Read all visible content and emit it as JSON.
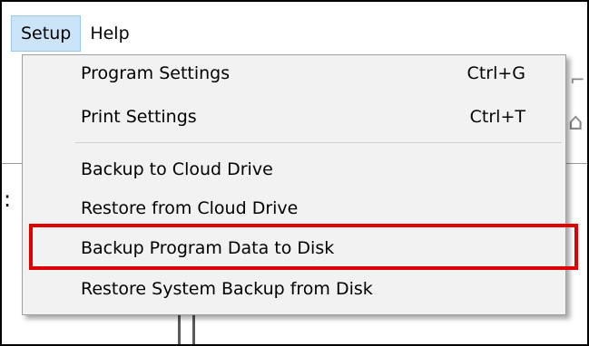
{
  "menubar": {
    "items": [
      {
        "label": "Setup",
        "active": true
      },
      {
        "label": "Help",
        "active": false
      }
    ]
  },
  "dropdown": {
    "items": [
      {
        "label": "Program Settings",
        "shortcut": "Ctrl+G"
      },
      {
        "label": "Print Settings",
        "shortcut": "Ctrl+T"
      },
      {
        "label": "Backup to Cloud Drive",
        "shortcut": ""
      },
      {
        "label": "Restore from Cloud Drive",
        "shortcut": ""
      },
      {
        "label": "Backup Program Data to Disk",
        "shortcut": "",
        "highlighted": true
      },
      {
        "label": "Restore System Backup from Disk",
        "shortcut": ""
      }
    ]
  },
  "colors": {
    "menu_bg": "#f2f2f2",
    "active_menubar_bg": "#cce4f7",
    "annotation_box": "#e00000"
  }
}
